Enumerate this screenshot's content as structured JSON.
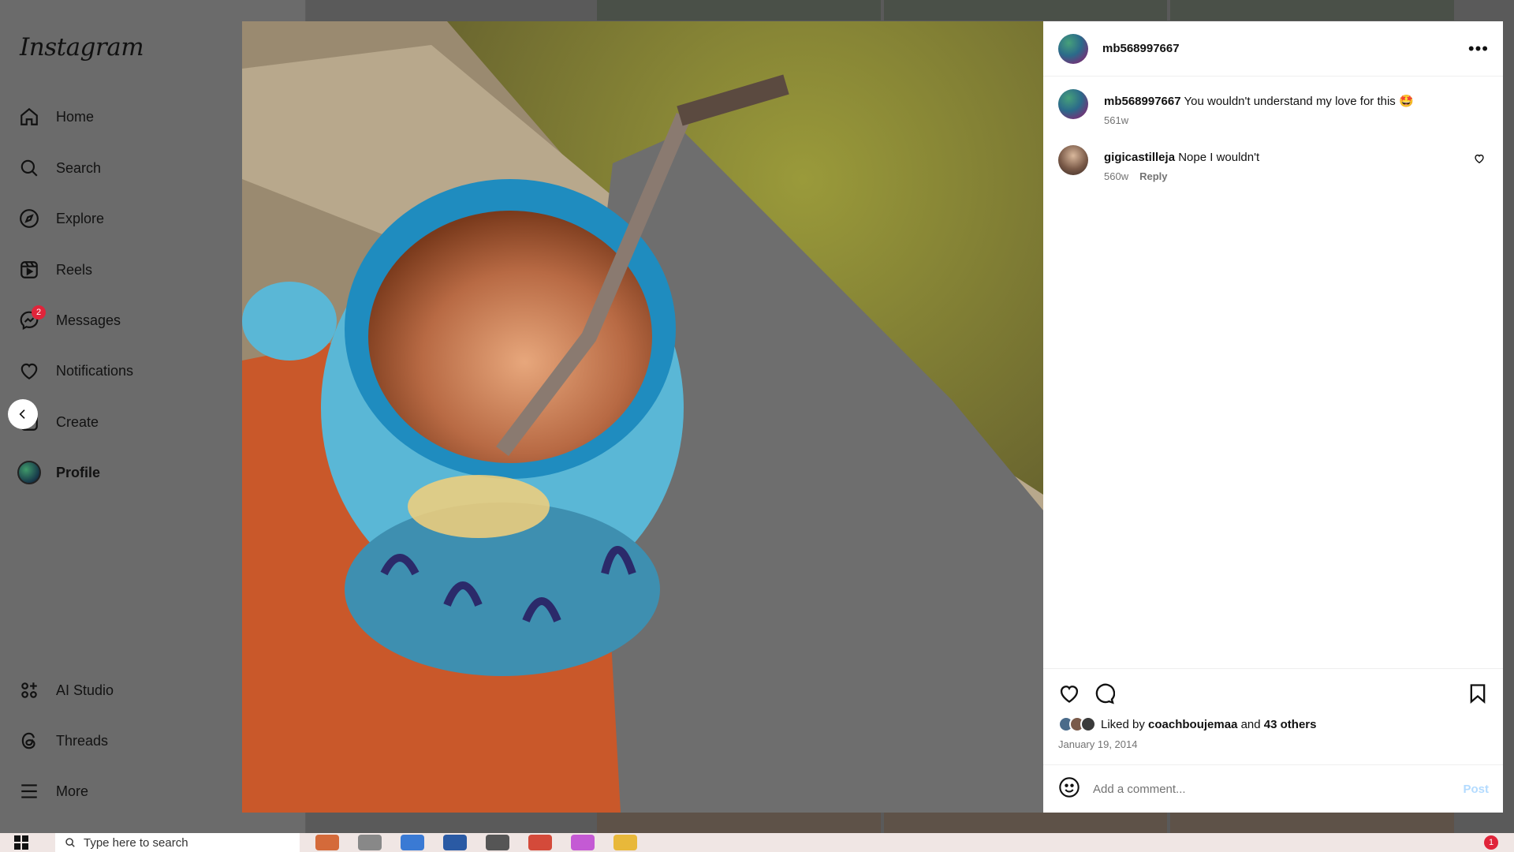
{
  "sidebar": {
    "logo": "Instagram",
    "items": [
      {
        "label": "Home",
        "icon": "home-icon"
      },
      {
        "label": "Search",
        "icon": "search-icon"
      },
      {
        "label": "Explore",
        "icon": "compass-icon"
      },
      {
        "label": "Reels",
        "icon": "reels-icon"
      },
      {
        "label": "Messages",
        "icon": "messenger-icon",
        "badge": "2"
      },
      {
        "label": "Notifications",
        "icon": "heart-icon"
      },
      {
        "label": "Create",
        "icon": "plus-icon"
      },
      {
        "label": "Profile",
        "icon": "profile-avatar"
      },
      {
        "label": "AI Studio",
        "icon": "ai-studio-icon"
      },
      {
        "label": "Threads",
        "icon": "threads-icon"
      },
      {
        "label": "More",
        "icon": "menu-icon"
      }
    ]
  },
  "post": {
    "username": "mb568997667",
    "caption": {
      "username": "mb568997667",
      "text": "You wouldn't understand my love for this 🤩",
      "time": "561w"
    },
    "comments": [
      {
        "username": "gigicastilleja",
        "text": "Nope I wouldn't",
        "time": "560w",
        "reply_label": "Reply"
      }
    ],
    "liked_by_prefix": "Liked by",
    "liked_by_user": "coachboujemaa",
    "liked_by_and": "and",
    "liked_by_others": "43 others",
    "date": "January 19, 2014",
    "add_comment_placeholder": "Add a comment...",
    "post_label": "Post"
  },
  "taskbar": {
    "search_placeholder": "Type here to search",
    "notification_badge": "1"
  },
  "colors": {
    "accent": "#0095f6",
    "post_disabled": "#b3dbff",
    "badge": "#e0243a",
    "overlay": "#5a5a5a"
  }
}
